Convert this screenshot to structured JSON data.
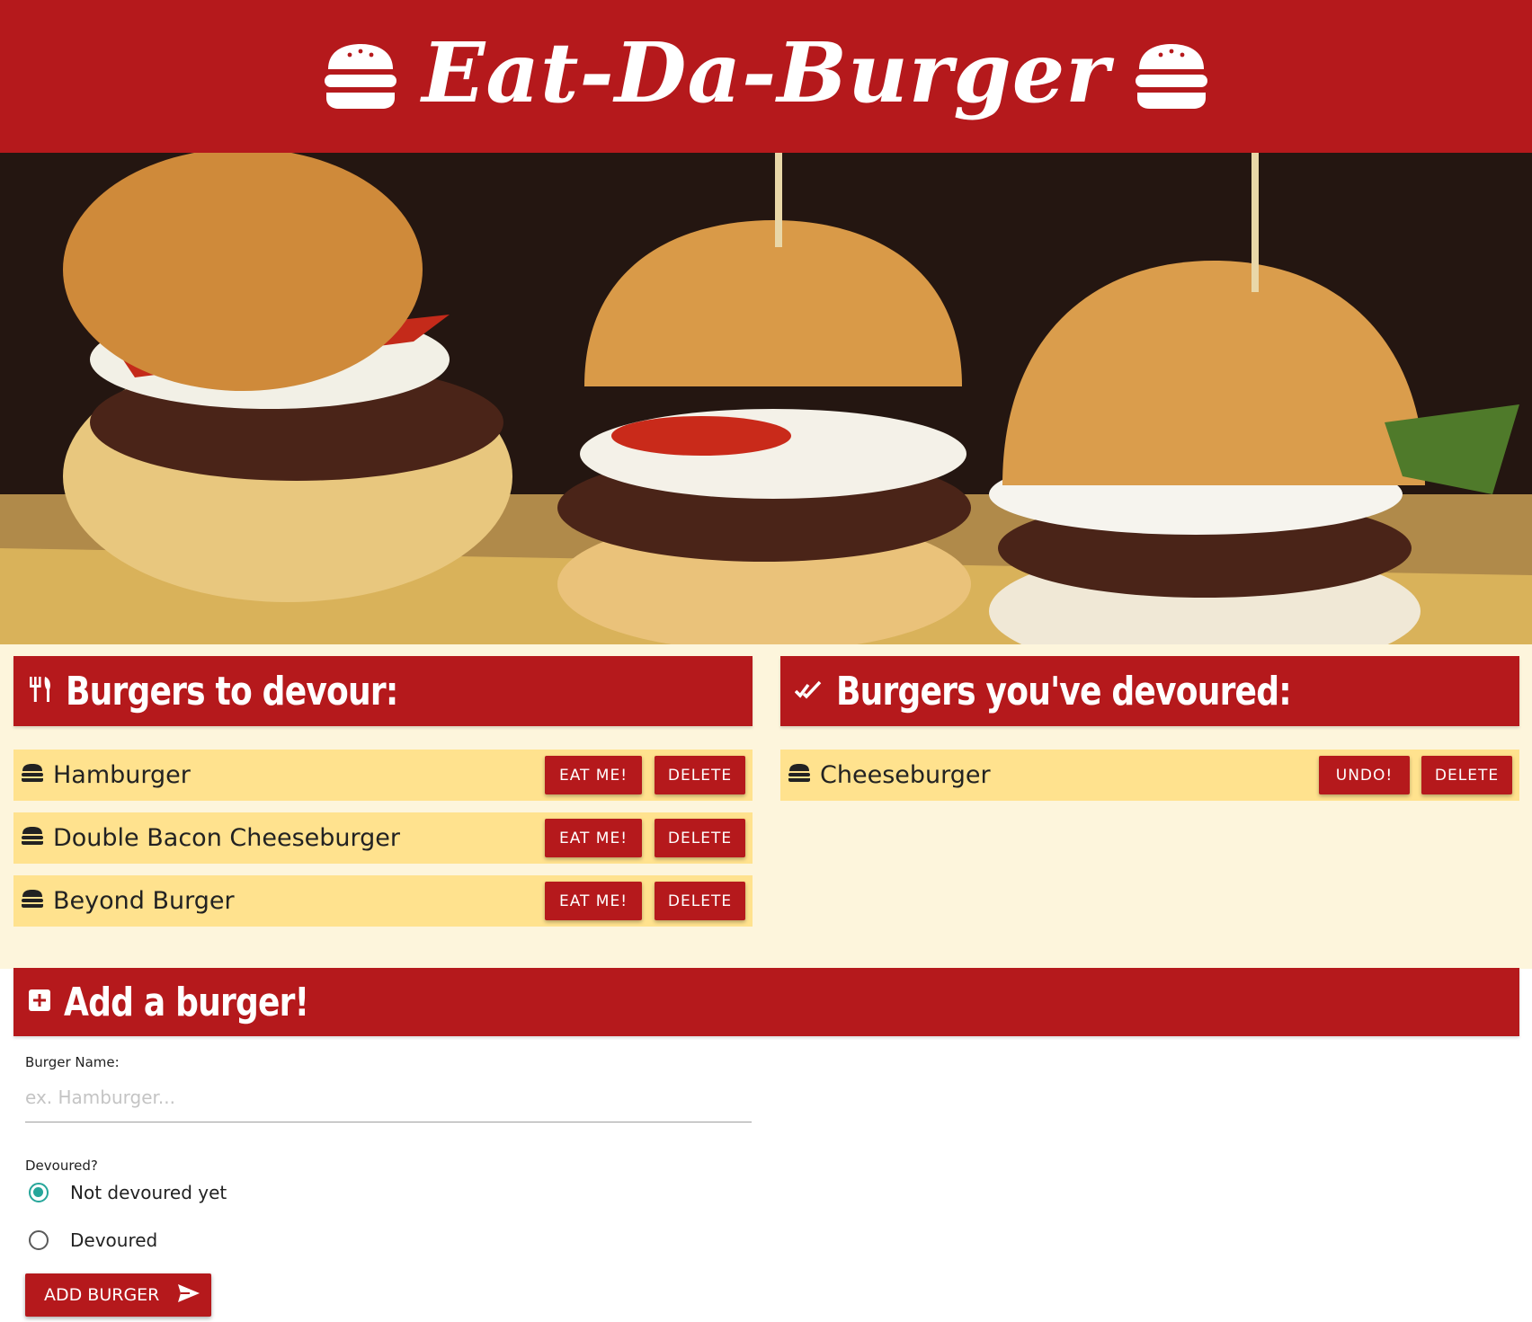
{
  "header": {
    "title": "Eat-Da-Burger",
    "left_icon": "burger-icon",
    "right_icon": "burger-icon"
  },
  "hero": {
    "alt": "three-burgers-photo"
  },
  "to_devour": {
    "title": "Burgers to devour:",
    "icon": "utensils-icon",
    "items": [
      {
        "name": "Hamburger",
        "eat_label": "EAT ME!",
        "delete_label": "DELETE"
      },
      {
        "name": "Double Bacon Cheeseburger",
        "eat_label": "EAT ME!",
        "delete_label": "DELETE"
      },
      {
        "name": "Beyond Burger",
        "eat_label": "EAT ME!",
        "delete_label": "DELETE"
      }
    ]
  },
  "devoured": {
    "title": "Burgers you've devoured:",
    "icon": "double-check-icon",
    "items": [
      {
        "name": "Cheeseburger",
        "undo_label": "UNDO!",
        "delete_label": "DELETE"
      }
    ]
  },
  "add": {
    "title": "Add a burger!",
    "icon": "plus-square-icon",
    "name_label": "Burger Name:",
    "name_placeholder": "ex. Hamburger...",
    "devoured_label": "Devoured?",
    "options": [
      {
        "label": "Not devoured yet",
        "selected": true
      },
      {
        "label": "Devoured",
        "selected": false
      }
    ],
    "submit_label": "ADD BURGER"
  },
  "colors": {
    "brand_red": "#b5191c",
    "cream": "#fdf5dc",
    "row_yellow": "#ffe28e",
    "radio_teal": "#26a69a"
  }
}
